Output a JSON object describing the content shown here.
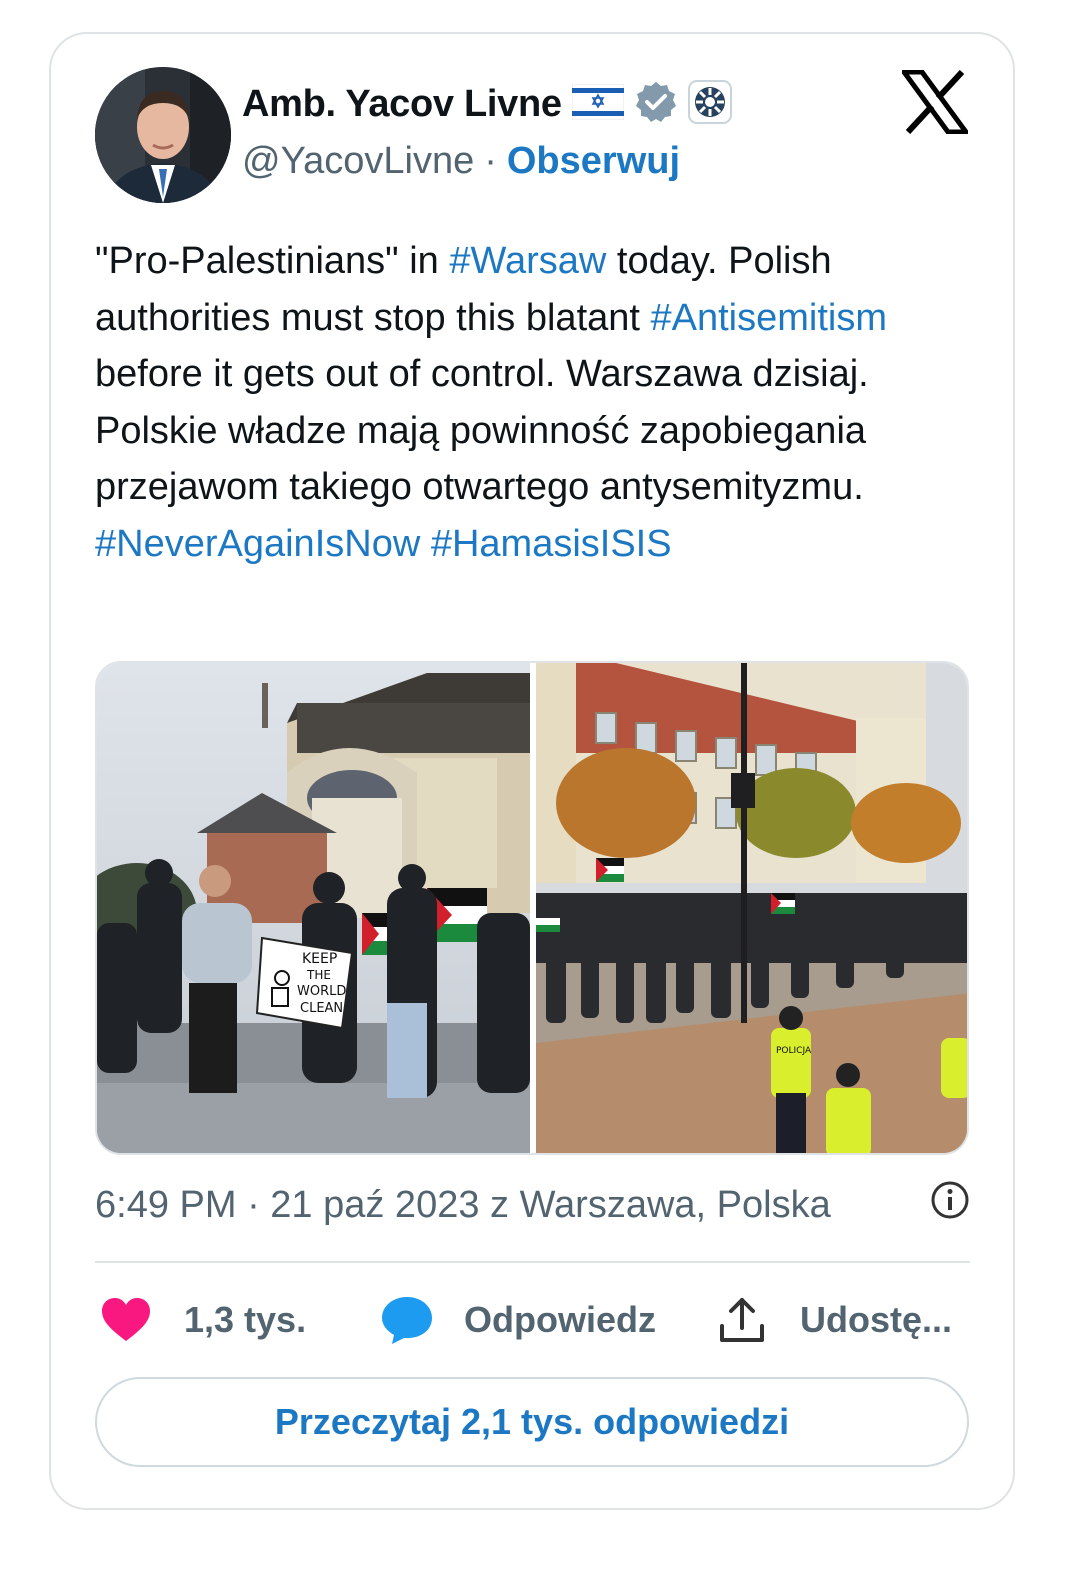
{
  "author": {
    "name": "Amb. Yacov Livne",
    "handle": "@YacovLivne",
    "separator": "·",
    "follow_label": "Obserwuj"
  },
  "tweet": {
    "segments": [
      {
        "text": "\"Pro-Palestinians\" in ",
        "type": "text"
      },
      {
        "text": "#Warsaw",
        "type": "hashtag"
      },
      {
        "text": " today. Polish authorities must stop this blatant ",
        "type": "text"
      },
      {
        "text": "#Antisemitism",
        "type": "hashtag"
      },
      {
        "text": " before it gets out of control. Warszawa dzisiaj. Polskie władze mają powinność zapobiegania przejawom takiego otwartego antysemityzmu. ",
        "type": "text"
      },
      {
        "text": "#NeverAgainIsNow",
        "type": "hashtag"
      },
      {
        "text": " ",
        "type": "text"
      },
      {
        "text": "#HamasisISIS",
        "type": "hashtag"
      }
    ]
  },
  "media": {
    "sign_lines": [
      "KEEP",
      "THE",
      "WORLD",
      "CLEAN"
    ],
    "police_label": "POLICJA"
  },
  "meta": {
    "timestamp": "6:49 PM · 21 paź 2023 z Warszawa, Polska",
    "info_icon": "info-icon"
  },
  "actions": {
    "likes": "1,3 tys.",
    "reply_label": "Odpowiedz",
    "share_label": "Udostę..."
  },
  "read_replies_label": "Przeczytaj 2,1 tys. odpowiedzi",
  "colors": {
    "link": "#1d78c4",
    "like": "#f91880",
    "reply_bubble": "#1d9bf0",
    "secondary_text": "#536471",
    "border": "#dfe3e6"
  }
}
